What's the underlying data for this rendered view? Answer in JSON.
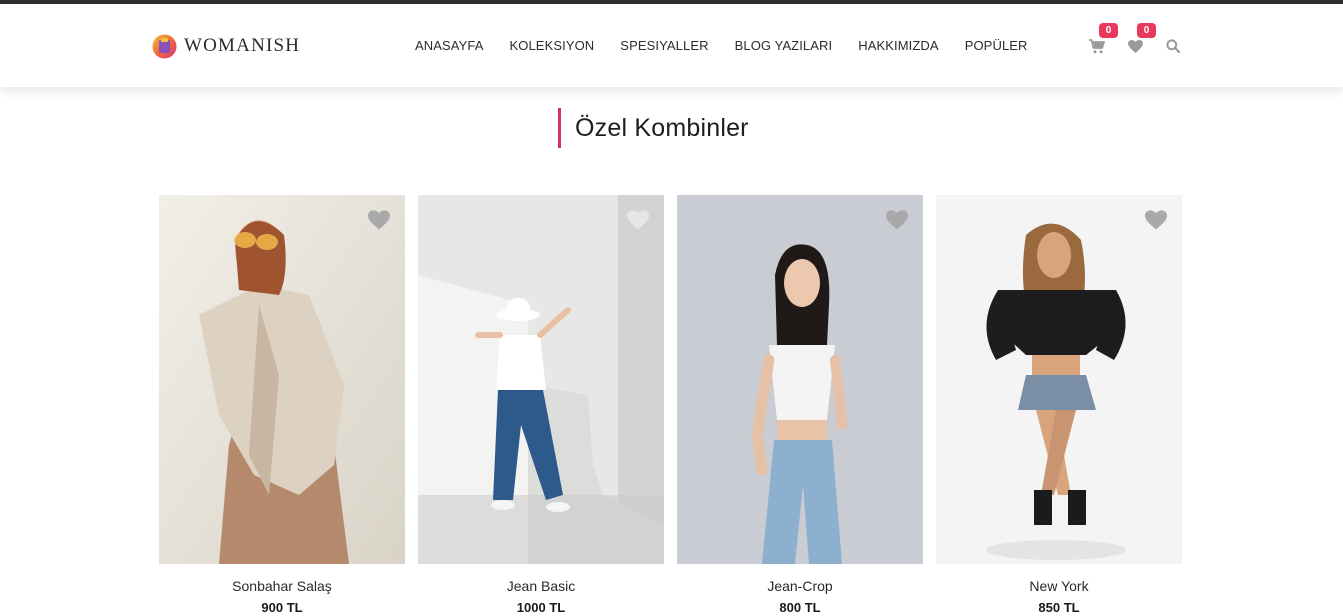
{
  "brand": {
    "name": "WOMANISH"
  },
  "nav": {
    "items": [
      "ANASAYFA",
      "KOLEKSIYON",
      "SPESIYALLER",
      "BLOG YAZILARI",
      "HAKKIMIZDA",
      "POPÜLER"
    ]
  },
  "header_icons": {
    "cart": {
      "icon": "cart-icon",
      "count": "0"
    },
    "wishlist": {
      "icon": "heart-icon",
      "count": "0"
    },
    "search": {
      "icon": "search-icon"
    }
  },
  "section": {
    "title": "Özel Kombinler"
  },
  "products": [
    {
      "name": "Sonbahar Salaş",
      "price": "900 TL"
    },
    {
      "name": "Jean Basic",
      "price": "1000 TL"
    },
    {
      "name": "Jean-Crop",
      "price": "800 TL"
    },
    {
      "name": "New York",
      "price": "850 TL"
    }
  ],
  "colors": {
    "accent": "#d1306b",
    "badge": "#e8395c",
    "icon_gray": "#9a9a9a"
  }
}
